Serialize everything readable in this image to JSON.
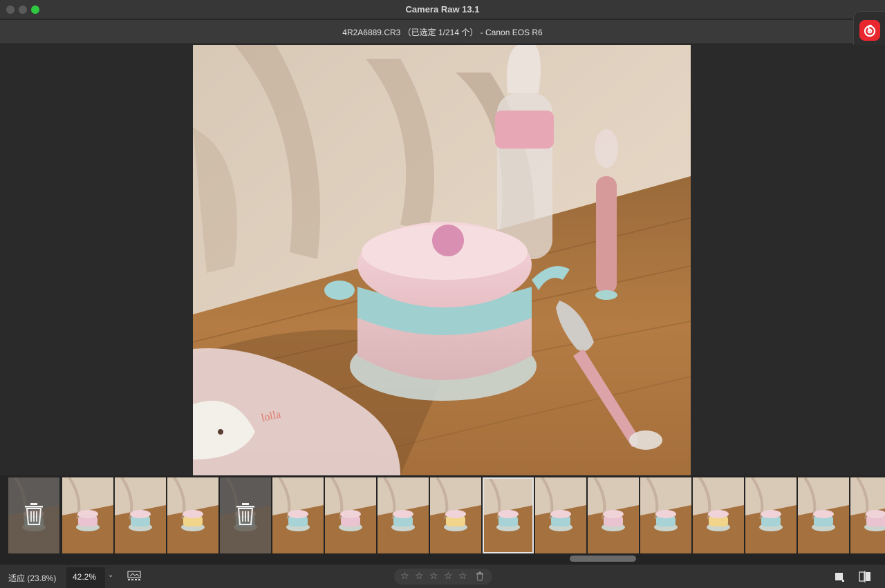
{
  "window": {
    "app_title": "Camera Raw 13.1"
  },
  "header": {
    "file_info": "4R2A6889.CR3 （已选定 1/214 个） -  Canon EOS R6"
  },
  "filmstrip": {
    "thumbnails": [
      {
        "index": 1,
        "state": "rejected"
      },
      {
        "index": 2,
        "state": "normal"
      },
      {
        "index": 3,
        "state": "normal"
      },
      {
        "index": 4,
        "state": "normal"
      },
      {
        "index": 5,
        "state": "rejected"
      },
      {
        "index": 6,
        "state": "normal"
      },
      {
        "index": 7,
        "state": "normal"
      },
      {
        "index": 8,
        "state": "normal"
      },
      {
        "index": 9,
        "state": "normal"
      },
      {
        "index": 10,
        "state": "selected"
      },
      {
        "index": 11,
        "state": "normal"
      },
      {
        "index": 12,
        "state": "normal"
      },
      {
        "index": 13,
        "state": "normal"
      },
      {
        "index": 14,
        "state": "normal"
      },
      {
        "index": 15,
        "state": "normal"
      },
      {
        "index": 16,
        "state": "normal"
      },
      {
        "index": 17,
        "state": "normal"
      }
    ]
  },
  "bottombar": {
    "fit_label": "适应 (23.8%)",
    "zoom_value": "42.2%",
    "zoom_chevron": "⌄",
    "stars": [
      "☆",
      "☆",
      "☆",
      "☆",
      "☆"
    ],
    "rating": 0
  },
  "colors": {
    "accent_close": "#5a5a5a",
    "accent_max": "#2fc840",
    "external_app": "#e8272f"
  },
  "icons": {
    "filmstrip_toggle": "filmstrip-icon",
    "trash": "trash-icon",
    "single_view": "single-view-icon",
    "compare_view": "compare-view-icon",
    "external_app": "netease-music-icon"
  }
}
